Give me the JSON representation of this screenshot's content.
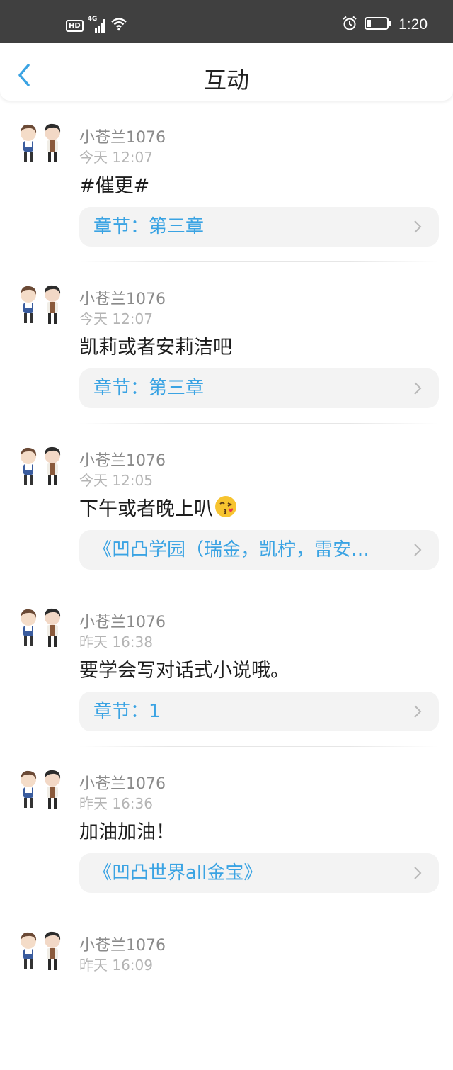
{
  "status_bar": {
    "hd": "HD",
    "network": "4G",
    "time": "1:20"
  },
  "header": {
    "title": "互动"
  },
  "colors": {
    "accent": "#3aa3e3",
    "status_bar_bg": "#404040",
    "card_bg": "#f3f3f3"
  },
  "items": [
    {
      "username": "小苍兰1076",
      "time": "今天 12:07",
      "comment": "#催更#",
      "link": "章节：第三章"
    },
    {
      "username": "小苍兰1076",
      "time": "今天 12:07",
      "comment": "凯莉或者安莉洁吧",
      "link": "章节：第三章"
    },
    {
      "username": "小苍兰1076",
      "time": "今天 12:05",
      "comment": "下午或者晚上叭",
      "emoji": "kissing-face-emoji",
      "link": "《凹凸学园（瑞金，凯柠，雷安…"
    },
    {
      "username": "小苍兰1076",
      "time": "昨天 16:38",
      "comment": "要学会写对话式小说哦。",
      "link": "章节：1"
    },
    {
      "username": "小苍兰1076",
      "time": "昨天 16:36",
      "comment": "加油加油！",
      "link": "《凹凸世界all金宝》"
    },
    {
      "username": "小苍兰1076",
      "time": "昨天 16:09"
    }
  ]
}
